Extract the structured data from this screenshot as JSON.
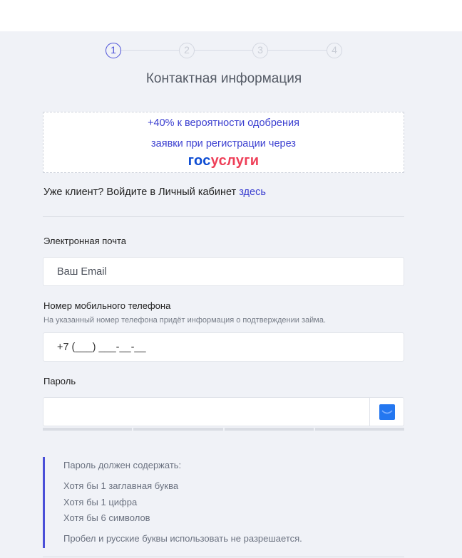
{
  "stepper": {
    "steps": [
      {
        "label": "1",
        "active": true
      },
      {
        "label": "2",
        "active": false
      },
      {
        "label": "3",
        "active": false
      },
      {
        "label": "4",
        "active": false
      }
    ]
  },
  "page": {
    "title": "Контактная информация"
  },
  "promo": {
    "line1": "+40% к вероятности одобрения",
    "line2": "заявки при регистрации через",
    "logo_part1": "гос",
    "logo_part2": "услуги"
  },
  "login": {
    "text": "Уже клиент? Войдите в Личный кабинет ",
    "link": "здесь"
  },
  "email": {
    "label": "Электронная почта",
    "placeholder": "Ваш Email"
  },
  "phone": {
    "label": "Номер мобильного телефона",
    "hint": "На указанный номер телефона придёт информация о подтверждении займа.",
    "value": "+7 (___) ___-__-__"
  },
  "password": {
    "label": "Пароль",
    "value": "",
    "strength_segments": 4,
    "strength_filled": 0
  },
  "rules": {
    "title": "Пароль должен содержать:",
    "items": [
      "Хотя бы 1 заглавная буква",
      "Хотя бы 1 цифра",
      "Хотя бы 6 символов"
    ],
    "note": "Пробел и русские буквы использовать не разрешается."
  },
  "colors": {
    "accent": "#4a4fd8",
    "link": "#3b3fd0",
    "gos_blue": "#0d4cd3",
    "gos_red": "#ee3f58",
    "eye_button": "#2477f0"
  }
}
